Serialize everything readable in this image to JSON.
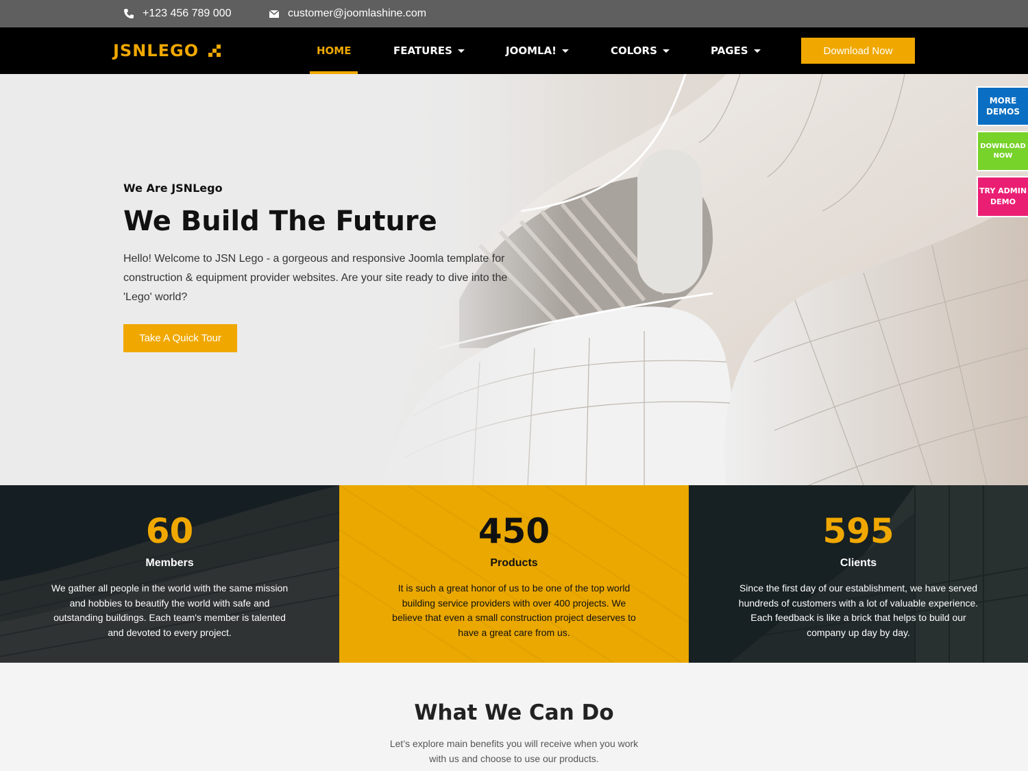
{
  "topbar": {
    "phone": "+123 456 789 000",
    "email": "customer@joomlashine.com",
    "phone_icon": "phone-icon",
    "email_icon": "envelope-icon"
  },
  "nav": {
    "logo": "JSNLEGO",
    "items": [
      {
        "label": "HOME",
        "active": true,
        "dropdown": false
      },
      {
        "label": "FEATURES",
        "active": false,
        "dropdown": true
      },
      {
        "label": "JOOMLA!",
        "active": false,
        "dropdown": true
      },
      {
        "label": "COLORS",
        "active": false,
        "dropdown": true
      },
      {
        "label": "PAGES",
        "active": false,
        "dropdown": true
      }
    ],
    "download_label": "Download Now"
  },
  "hero": {
    "kicker": "We Are JSNLego",
    "title": "We Build The Future",
    "description": "Hello! Welcome to JSN Lego - a gorgeous and responsive Joomla template for construction & equipment provider websites. Are your site ready to dive into the 'Lego' world?",
    "cta": "Take A Quick Tour"
  },
  "side_buttons": {
    "more_demos": "MORE DEMOS",
    "download_now": "DOWNLOAD NOW",
    "try_admin": "TRY ADMIN DEMO"
  },
  "stats": [
    {
      "number": "60",
      "label": "Members",
      "text": "We gather all people in the world with the same mission and hobbies to beautify the world with safe and outstanding buildings. Each team's member is talented and devoted to every project."
    },
    {
      "number": "450",
      "label": "Products",
      "text": "It is such a great honor of us to be one of the top world building service providers with over 400 projects. We believe that even a small construction project deserves to have a great care from us."
    },
    {
      "number": "595",
      "label": "Clients",
      "text": "Since the first day of our establishment, we have served hundreds of customers with a lot of valuable experience. Each feedback is like a brick that helps to build our company up day by day."
    }
  ],
  "section": {
    "heading": "What We Can Do",
    "text": "Let’s explore main benefits you will receive when you work with us and choose to use our products."
  },
  "colors": {
    "accent": "#f0a800",
    "topbar": "#5f5f5f",
    "navbar": "#000000",
    "demos_blue": "#0a6fc2",
    "download_green": "#77d22a",
    "admin_pink": "#ea1f74"
  }
}
